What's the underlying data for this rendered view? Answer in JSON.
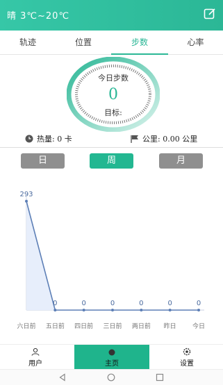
{
  "status": {
    "weather_text": "晴  3℃~20℃"
  },
  "tabs": [
    "轨迹",
    "位置",
    "步数",
    "心率"
  ],
  "active_tab_index": 2,
  "steps": {
    "today_label": "今日步数",
    "count": "0",
    "goal_label": "目标:"
  },
  "stats": {
    "calories_text": "热量: 0 卡",
    "distance_text": "公里: 0.00 公里"
  },
  "periods": [
    "日",
    "周",
    "月"
  ],
  "active_period_index": 1,
  "chart_data": {
    "type": "area",
    "categories": [
      "六日前",
      "五日前",
      "四日前",
      "三日前",
      "两日前",
      "昨日",
      "今日"
    ],
    "values": [
      293,
      0,
      0,
      0,
      0,
      0,
      0
    ],
    "data_labels": [
      "293",
      "0",
      "0",
      "0",
      "0",
      "0",
      "0"
    ],
    "ylim": [
      0,
      293
    ],
    "line_color": "#5d7fb6",
    "fill_color": "#e7eefb",
    "grid": false
  },
  "bottom_nav": {
    "user_label": "用户",
    "home_label": "主页",
    "settings_label": "设置"
  },
  "colors": {
    "accent": "#2bb796",
    "inactive": "#8f8f8f"
  }
}
